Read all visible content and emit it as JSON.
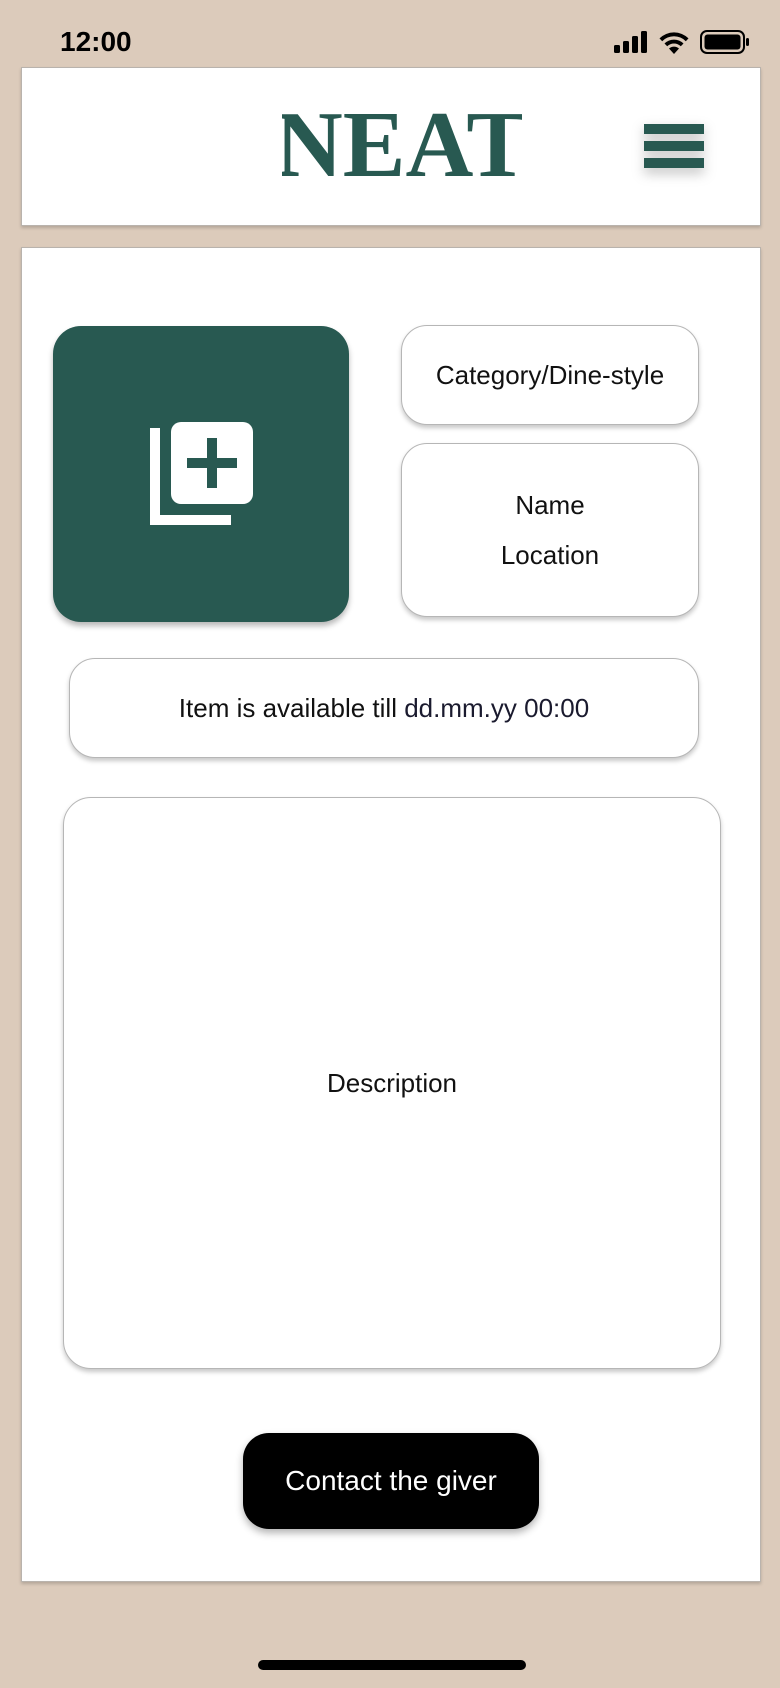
{
  "status_bar": {
    "time": "12:00"
  },
  "header": {
    "logo_text": "NEAT",
    "menu_icon": "hamburger-menu-icon"
  },
  "item": {
    "add_photo_icon": "add-photo-icon",
    "category": "Category/Dine-style",
    "name": "Name",
    "location": "Location",
    "availability_prefix": "Item is available till",
    "availability_date": "dd.mm.yy 00:00",
    "description": "Description"
  },
  "actions": {
    "contact_label": "Contact the giver"
  },
  "colors": {
    "brand": "#285951",
    "background": "#dccbbb",
    "button": "#000000"
  }
}
